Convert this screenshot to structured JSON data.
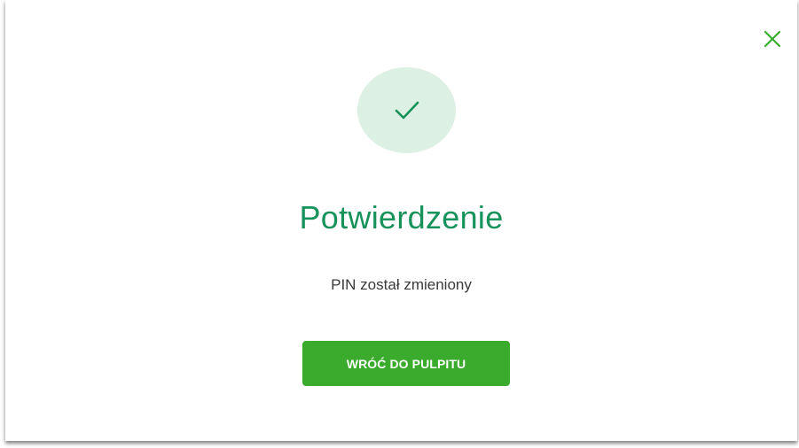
{
  "dialog": {
    "title": "Potwierdzenie",
    "message": "PIN został zmieniony",
    "primary_button_label": "WRÓĆ DO PULPITU",
    "close_icon": "close-icon",
    "status_icon": "checkmark-icon"
  },
  "colors": {
    "accent_green": "#16925a",
    "button_green": "#3aab2c",
    "success_circle": "#dcf0e3",
    "close_icon": "#3aab2c"
  }
}
